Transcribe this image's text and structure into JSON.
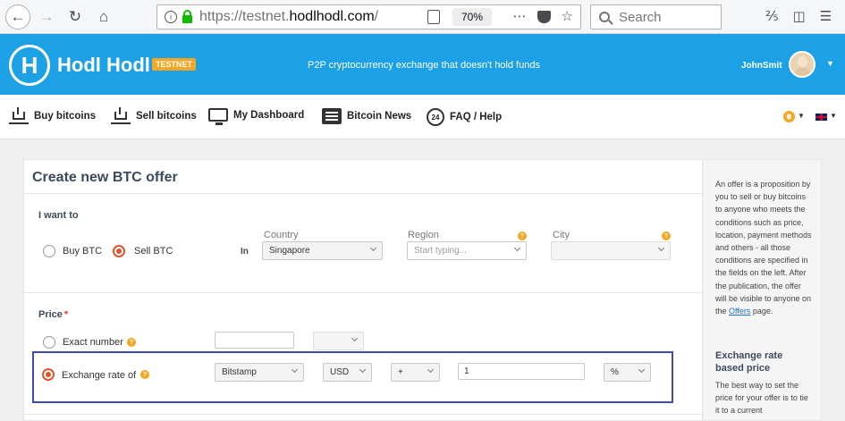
{
  "browser": {
    "url_host_prefix": "https://testnet.",
    "url_host_bold": "hodlhodl.com",
    "url_path": "/",
    "zoom": "70%",
    "search_placeholder": "Search"
  },
  "header": {
    "logo_text": "Hodl Hodl",
    "badge": "TESTNET",
    "tagline": "P2P cryptocurrency exchange that doesn't hold funds",
    "username": "JohnSmit"
  },
  "nav": {
    "items": [
      {
        "label": "Buy bitcoins",
        "icon": "cart-icon"
      },
      {
        "label": "Sell bitcoins",
        "icon": "cart-icon"
      },
      {
        "label": "My Dashboard",
        "icon": "monitor-icon"
      },
      {
        "label": "Bitcoin News",
        "icon": "newspaper-icon"
      },
      {
        "label": "FAQ / Help",
        "icon": "support-24-icon"
      }
    ],
    "currency_symbol": "฿"
  },
  "form": {
    "title": "Create new BTC offer",
    "i_want_to": "I want to",
    "buy_label": "Buy BTC",
    "sell_label": "Sell BTC",
    "in_label": "In",
    "country_label": "Country",
    "country_value": "Singapore",
    "region_label": "Region",
    "region_placeholder": "Start typing...",
    "city_label": "City",
    "price_label": "Price",
    "price_required": "*",
    "exact_number_label": "Exact number",
    "exchange_rate_label": "Exchange rate of",
    "exchange_source": "Bitstamp",
    "currency": "USD",
    "sign": "+",
    "margin_value": "1",
    "unit": "%"
  },
  "sidebar": {
    "intro_part1": "An offer is a proposition by you to sell or buy bitcoins to anyone who meets the conditions such as price, location, payment methods and others - all those conditions are specified in the fields on the left. After the publication, the offer will be visible to anyone on the ",
    "offers_link": "Offers",
    "intro_part2": " page.",
    "rate_title": "Exchange rate based price",
    "rate_text": "The best way to set the price for your offer is to tie it to a current"
  }
}
